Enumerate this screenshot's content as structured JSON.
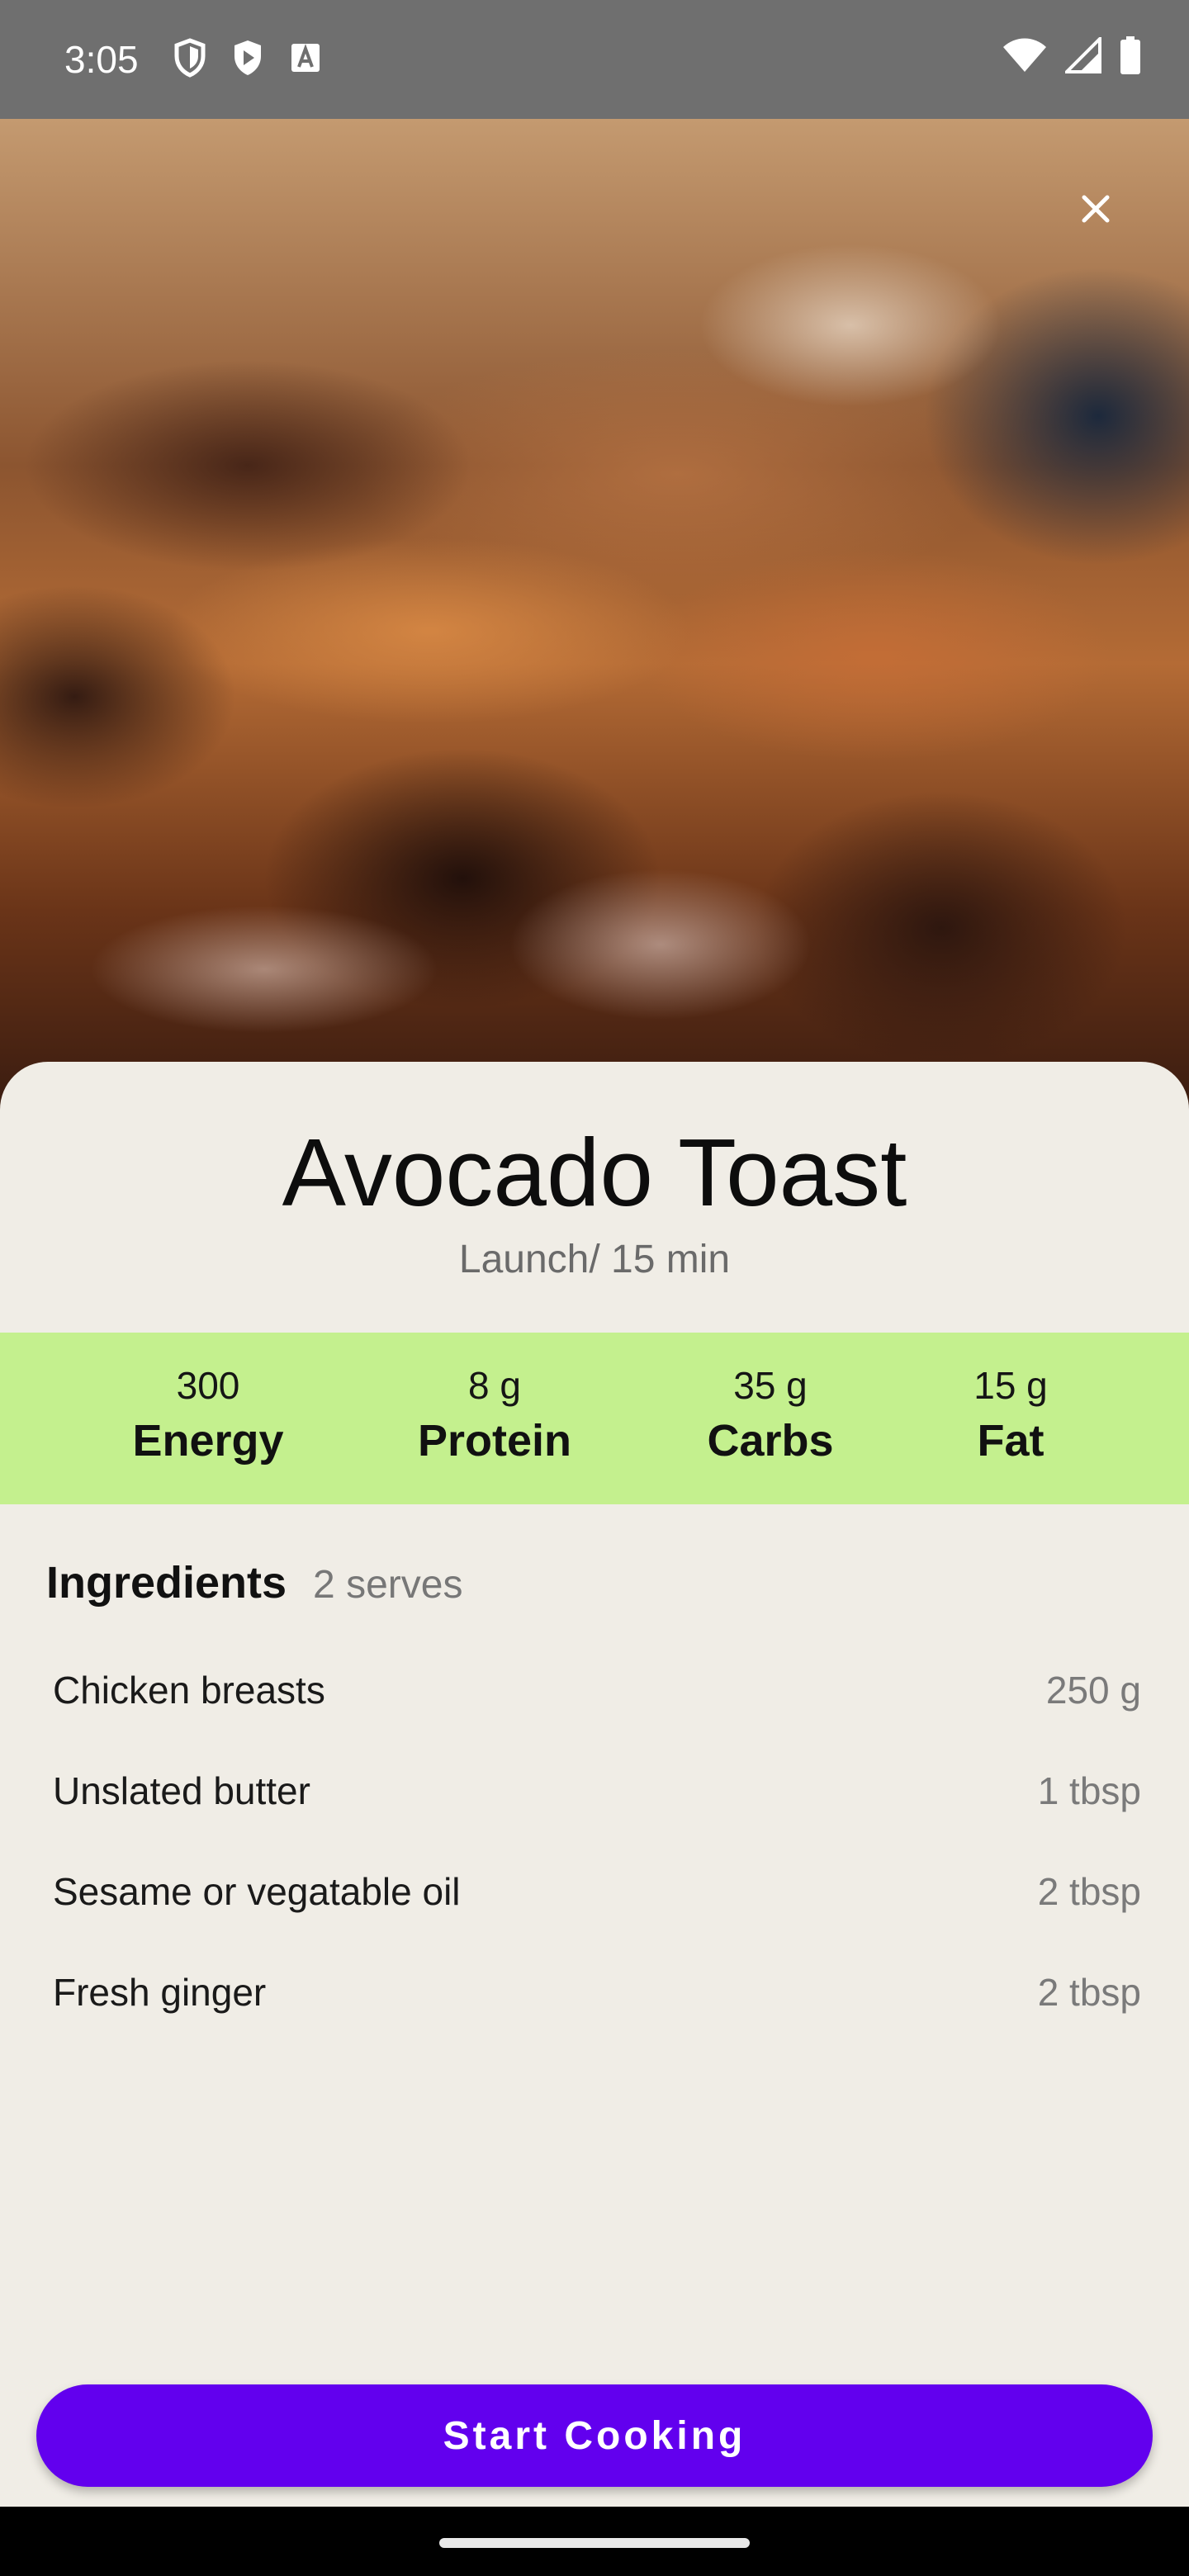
{
  "status_bar": {
    "time": "3:05",
    "left_icons": [
      "shield-outline-icon",
      "play-shield-icon",
      "a-badge-icon"
    ],
    "right_icons": [
      "wifi-icon",
      "signal-icon",
      "battery-icon"
    ]
  },
  "hero": {
    "image": "blurred-food-photo",
    "close_icon": "close-icon"
  },
  "recipe": {
    "title": "Avocado Toast",
    "subtitle": "Launch/ 15 min"
  },
  "nutrition": [
    {
      "value": "300",
      "label": "Energy"
    },
    {
      "value": "8 g",
      "label": "Protein"
    },
    {
      "value": "35 g",
      "label": "Carbs"
    },
    {
      "value": "15 g",
      "label": "Fat"
    }
  ],
  "ingredients": {
    "title": "Ingredients",
    "serves": "2 serves",
    "items": [
      {
        "name": "Chicken breasts",
        "qty": "250 g"
      },
      {
        "name": "Unslated butter",
        "qty": "1 tbsp"
      },
      {
        "name": "Sesame or vegatable oil",
        "qty": "2 tbsp"
      },
      {
        "name": "Fresh ginger",
        "qty": "2 tbsp"
      }
    ]
  },
  "actions": {
    "start_label": "Start Cooking"
  },
  "colors": {
    "accent": "#6200ee",
    "nutrition_band": "#c4f08e",
    "background": "#f0ede6",
    "status_bar": "#6f6f6f"
  }
}
